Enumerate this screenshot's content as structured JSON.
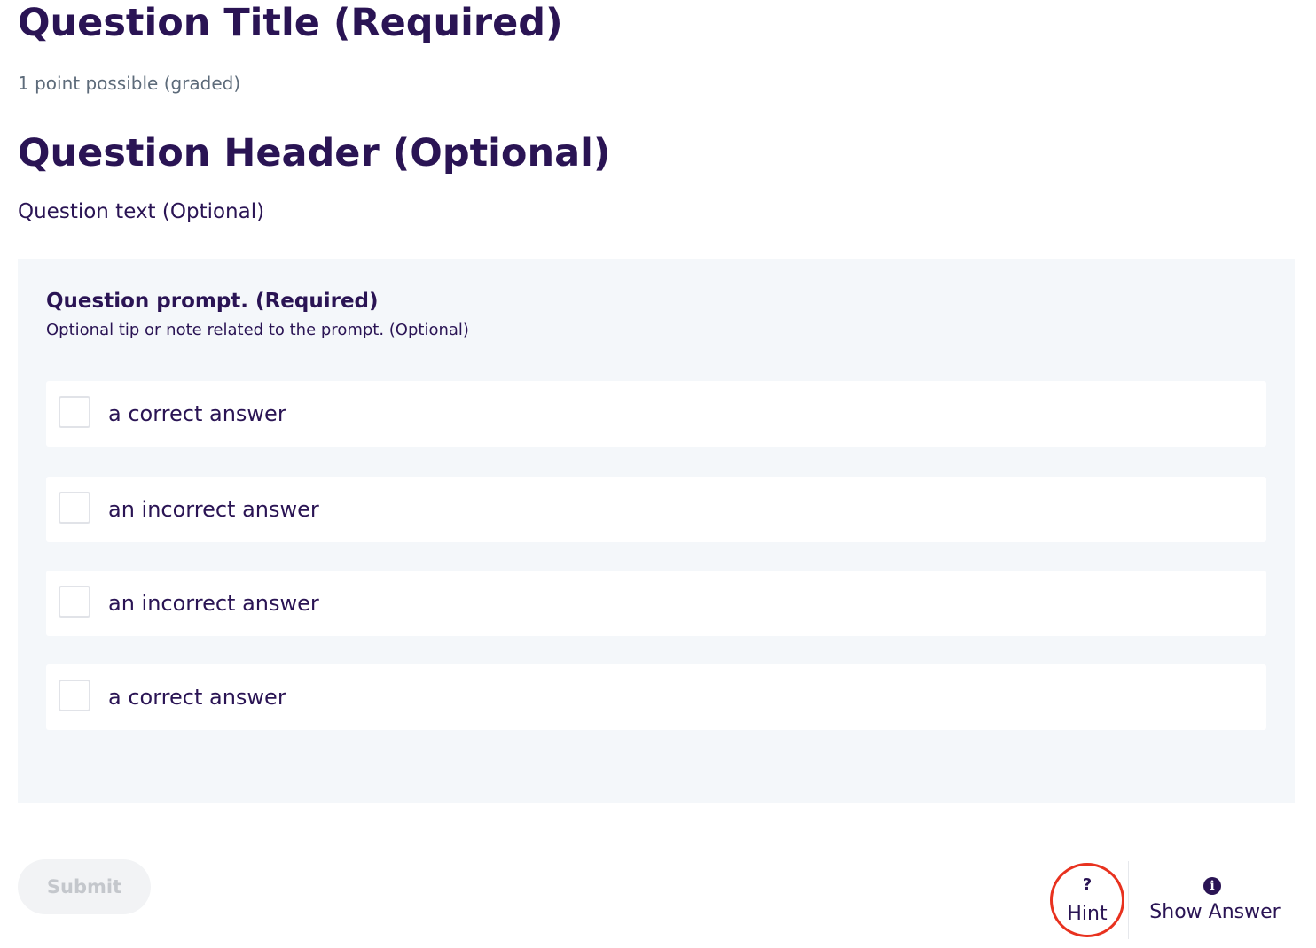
{
  "problem": {
    "title": "Question Title (Required)",
    "points": "1 point possible (graded)",
    "header": "Question Header (Optional)",
    "text": "Question text (Optional)"
  },
  "question": {
    "prompt": "Question prompt. (Required)",
    "tip": "Optional tip or note related to the prompt. (Optional)",
    "options": [
      {
        "label": "a correct answer",
        "checked": false
      },
      {
        "label": "an incorrect answer",
        "checked": false
      },
      {
        "label": "an incorrect answer",
        "checked": false
      },
      {
        "label": "a correct answer",
        "checked": false
      }
    ]
  },
  "actions": {
    "submit_label": "Submit",
    "submit_disabled": true,
    "hint_icon": "?",
    "hint_label": "Hint",
    "show_answer_icon": "i",
    "show_answer_label": "Show Answer"
  },
  "icons": {
    "hint": "question-mark-icon",
    "show_answer": "info-circle-icon"
  },
  "colors": {
    "primary_text": "#2a1454",
    "panel_background": "#f4f7fa",
    "highlight_ring": "#e8321f",
    "muted_text": "#5d6b7a"
  }
}
